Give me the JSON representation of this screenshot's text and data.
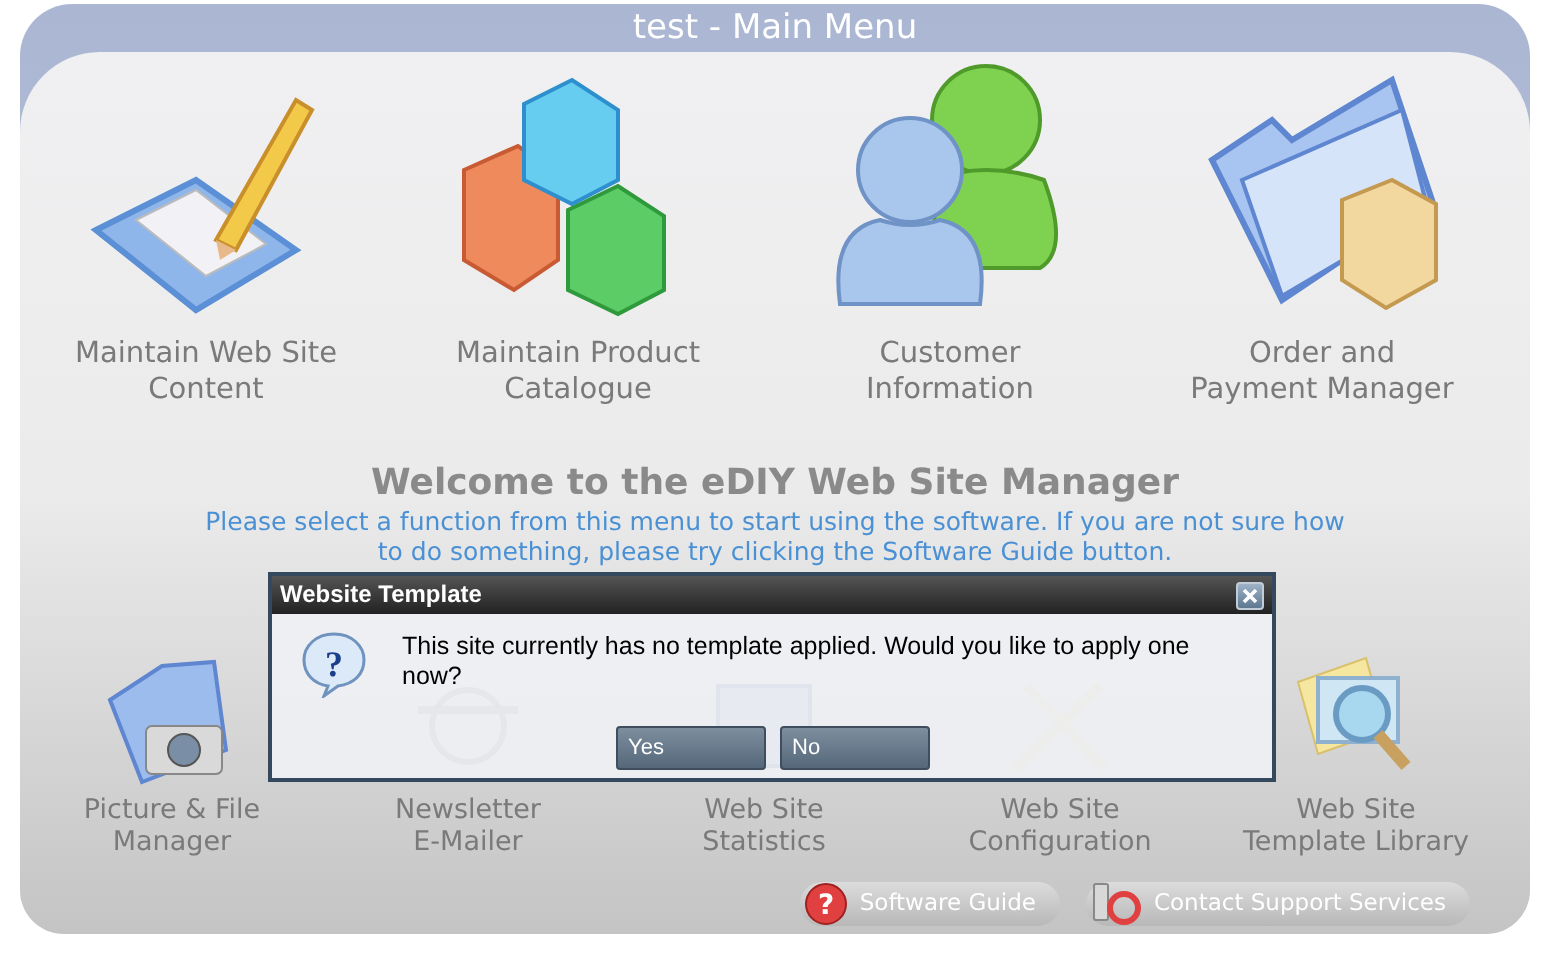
{
  "window": {
    "title": "test - Main Menu"
  },
  "main_functions": [
    {
      "kind": "content",
      "lines": [
        "Maintain Web Site",
        "Content"
      ]
    },
    {
      "kind": "products",
      "lines": [
        "Maintain Product",
        "Catalogue"
      ]
    },
    {
      "kind": "customers",
      "lines": [
        "Customer",
        "Information"
      ]
    },
    {
      "kind": "orders",
      "lines": [
        "Order and",
        "Payment Manager"
      ]
    }
  ],
  "welcome": {
    "heading": "Welcome to the eDIY Web Site Manager",
    "text": "Please select a function from this menu to start using the software.  If you are not sure how to do something, please try clicking the Software Guide button."
  },
  "tools": [
    {
      "kind": "pictures",
      "lines": [
        "Picture & File",
        "Manager"
      ]
    },
    {
      "kind": "newsletter",
      "lines": [
        "Newsletter",
        "E-Mailer"
      ]
    },
    {
      "kind": "statistics",
      "lines": [
        "Web Site",
        "Statistics"
      ]
    },
    {
      "kind": "configuration",
      "lines": [
        "Web Site",
        "Configuration"
      ]
    },
    {
      "kind": "templates",
      "lines": [
        "Web Site",
        "Template Library"
      ]
    }
  ],
  "footer_buttons": [
    {
      "kind": "help",
      "icon": "?",
      "label": "Software Guide"
    },
    {
      "kind": "support",
      "label": "Contact Support Services"
    }
  ],
  "dialog": {
    "title": "Website Template",
    "icon": "?",
    "message": "This site currently has no template applied. Would you like to apply one now?",
    "buttons": [
      "Yes",
      "No"
    ]
  }
}
